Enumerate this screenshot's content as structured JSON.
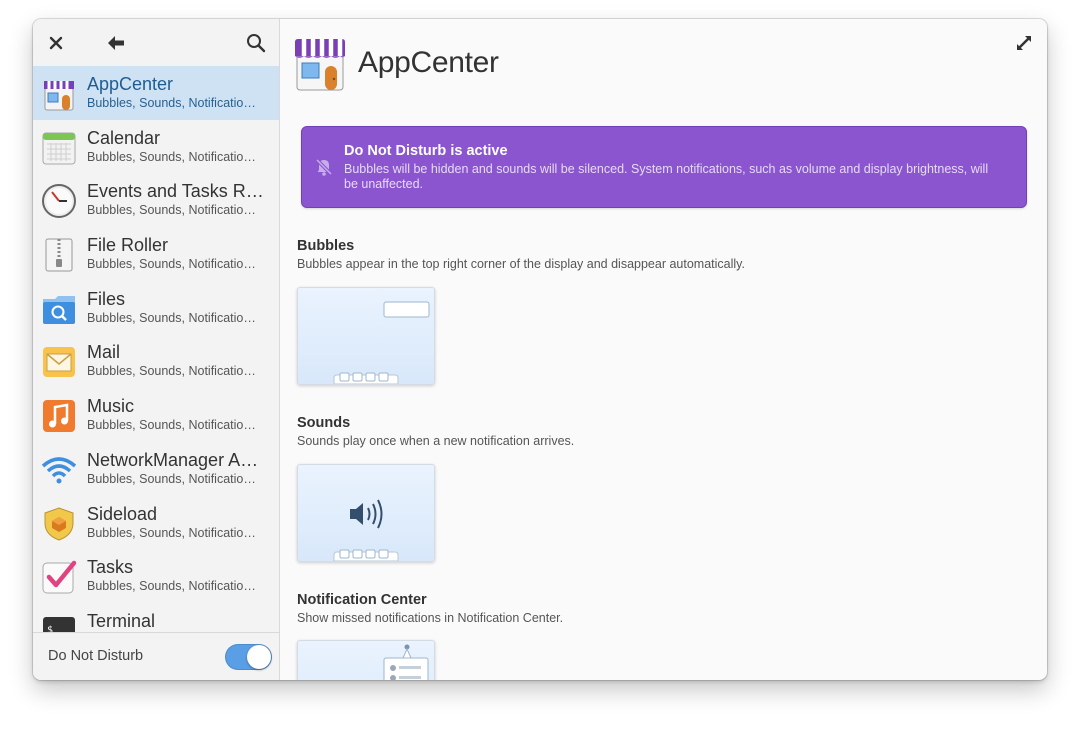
{
  "header": {
    "close_icon": "close-icon",
    "back_icon": "back-arrow-icon",
    "search_icon": "search-icon"
  },
  "apps": [
    {
      "name": "AppCenter",
      "subtitle": "Bubbles, Sounds, Notificatio…",
      "icon": "appcenter-icon",
      "selected": true
    },
    {
      "name": "Calendar",
      "subtitle": "Bubbles, Sounds, Notificatio…",
      "icon": "calendar-icon"
    },
    {
      "name": "Events and Tasks R…",
      "subtitle": "Bubbles, Sounds, Notificatio…",
      "icon": "clock-icon"
    },
    {
      "name": "File Roller",
      "subtitle": "Bubbles, Sounds, Notificatio…",
      "icon": "archive-icon"
    },
    {
      "name": "Files",
      "subtitle": "Bubbles, Sounds, Notificatio…",
      "icon": "folder-icon"
    },
    {
      "name": "Mail",
      "subtitle": "Bubbles, Sounds, Notificatio…",
      "icon": "mail-icon"
    },
    {
      "name": "Music",
      "subtitle": "Bubbles, Sounds, Notificatio…",
      "icon": "music-icon"
    },
    {
      "name": "NetworkManager A…",
      "subtitle": "Bubbles, Sounds, Notificatio…",
      "icon": "wifi-icon"
    },
    {
      "name": "Sideload",
      "subtitle": "Bubbles, Sounds, Notificatio…",
      "icon": "sideload-shield-icon"
    },
    {
      "name": "Tasks",
      "subtitle": "Bubbles, Sounds, Notificatio…",
      "icon": "tasks-checkmark-icon"
    },
    {
      "name": "Terminal",
      "subtitle": "",
      "icon": "terminal-icon"
    }
  ],
  "footer": {
    "dnd_label": "Do Not Disturb",
    "dnd_on": true
  },
  "main": {
    "title": "AppCenter",
    "icon": "appcenter-icon",
    "expand_icon": "expand-icon",
    "banner": {
      "title": "Do Not Disturb is active",
      "text": "Bubbles will be hidden and sounds will be silenced. System notifications, such as volume and display brightness, will be unaffected.",
      "icon": "notifications-muted-icon",
      "color": "#8b55d0"
    },
    "settings": [
      {
        "title": "Bubbles",
        "description": "Bubbles appear in the top right corner of the display and disappear automatically.",
        "enabled": true
      },
      {
        "title": "Sounds",
        "description": "Sounds play once when a new notification arrives.",
        "enabled": true
      },
      {
        "title": "Notification Center",
        "description": "Show missed notifications in Notification Center.",
        "enabled": true
      }
    ]
  },
  "colors": {
    "accent": "#5a9ee6",
    "selection": "#cfe2f3"
  }
}
